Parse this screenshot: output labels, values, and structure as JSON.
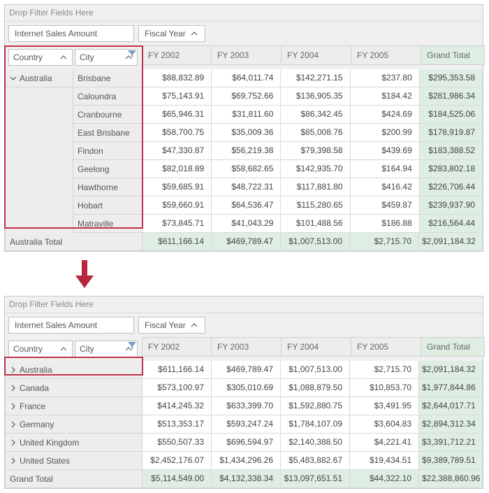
{
  "common": {
    "filter_placeholder": "Drop Filter Fields Here",
    "measure": "Internet Sales Amount",
    "col_field": "Fiscal Year",
    "row_field_country": "Country",
    "row_field_city": "City",
    "col_headers": [
      "FY 2002",
      "FY 2003",
      "FY 2004",
      "FY 2005"
    ],
    "grand_total_label": "Grand Total"
  },
  "top": {
    "parent": "Australia",
    "cities": [
      "Brisbane",
      "Caloundra",
      "Cranbourne",
      "East Brisbane",
      "Findon",
      "Geelong",
      "Hawthorne",
      "Hobart",
      "Matraville"
    ],
    "rows": [
      [
        "$88,832.89",
        "$64,011.74",
        "$142,271.15",
        "$237.80",
        "$295,353.58"
      ],
      [
        "$75,143.91",
        "$69,752.66",
        "$136,905.35",
        "$184.42",
        "$281,986.34"
      ],
      [
        "$65,946.31",
        "$31,811.60",
        "$86,342.45",
        "$424.69",
        "$184,525.06"
      ],
      [
        "$58,700.75",
        "$35,009.36",
        "$85,008.76",
        "$200.99",
        "$178,919.87"
      ],
      [
        "$47,330.87",
        "$56,219.38",
        "$79,398.58",
        "$439.69",
        "$183,388.52"
      ],
      [
        "$82,018.89",
        "$58,682.65",
        "$142,935.70",
        "$164.94",
        "$283,802.18"
      ],
      [
        "$59,685.91",
        "$48,722.31",
        "$117,881.80",
        "$416.42",
        "$226,706.44"
      ],
      [
        "$59,660.91",
        "$64,536.47",
        "$115,280.65",
        "$459.87",
        "$239,937.90"
      ],
      [
        "$73,845.71",
        "$41,043.29",
        "$101,488.56",
        "$186.88",
        "$216,564.44"
      ]
    ],
    "subtotal_label": "Australia Total",
    "subtotal": [
      "$611,166.14",
      "$469,789.47",
      "$1,007,513.00",
      "$2,715.70",
      "$2,091,184.32"
    ]
  },
  "bottom": {
    "countries": [
      "Australia",
      "Canada",
      "France",
      "Germany",
      "United Kingdom",
      "United States"
    ],
    "rows": [
      [
        "$611,166.14",
        "$469,789.47",
        "$1,007,513.00",
        "$2,715.70",
        "$2,091,184.32"
      ],
      [
        "$573,100.97",
        "$305,010.69",
        "$1,088,879.50",
        "$10,853.70",
        "$1,977,844.86"
      ],
      [
        "$414,245.32",
        "$633,399.70",
        "$1,592,880.75",
        "$3,491.95",
        "$2,644,017.71"
      ],
      [
        "$513,353.17",
        "$593,247.24",
        "$1,784,107.09",
        "$3,604.83",
        "$2,894,312.34"
      ],
      [
        "$550,507.33",
        "$696,594.97",
        "$2,140,388.50",
        "$4,221.41",
        "$3,391,712.21"
      ],
      [
        "$2,452,176.07",
        "$1,434,296.26",
        "$5,483,882.67",
        "$19,434.51",
        "$9,389,789.51"
      ]
    ],
    "grand_total_row_label": "Grand Total",
    "grand_total": [
      "$5,114,549.00",
      "$4,132,338.34",
      "$13,097,651.51",
      "$44,322.10",
      "$22,388,860.96"
    ]
  }
}
